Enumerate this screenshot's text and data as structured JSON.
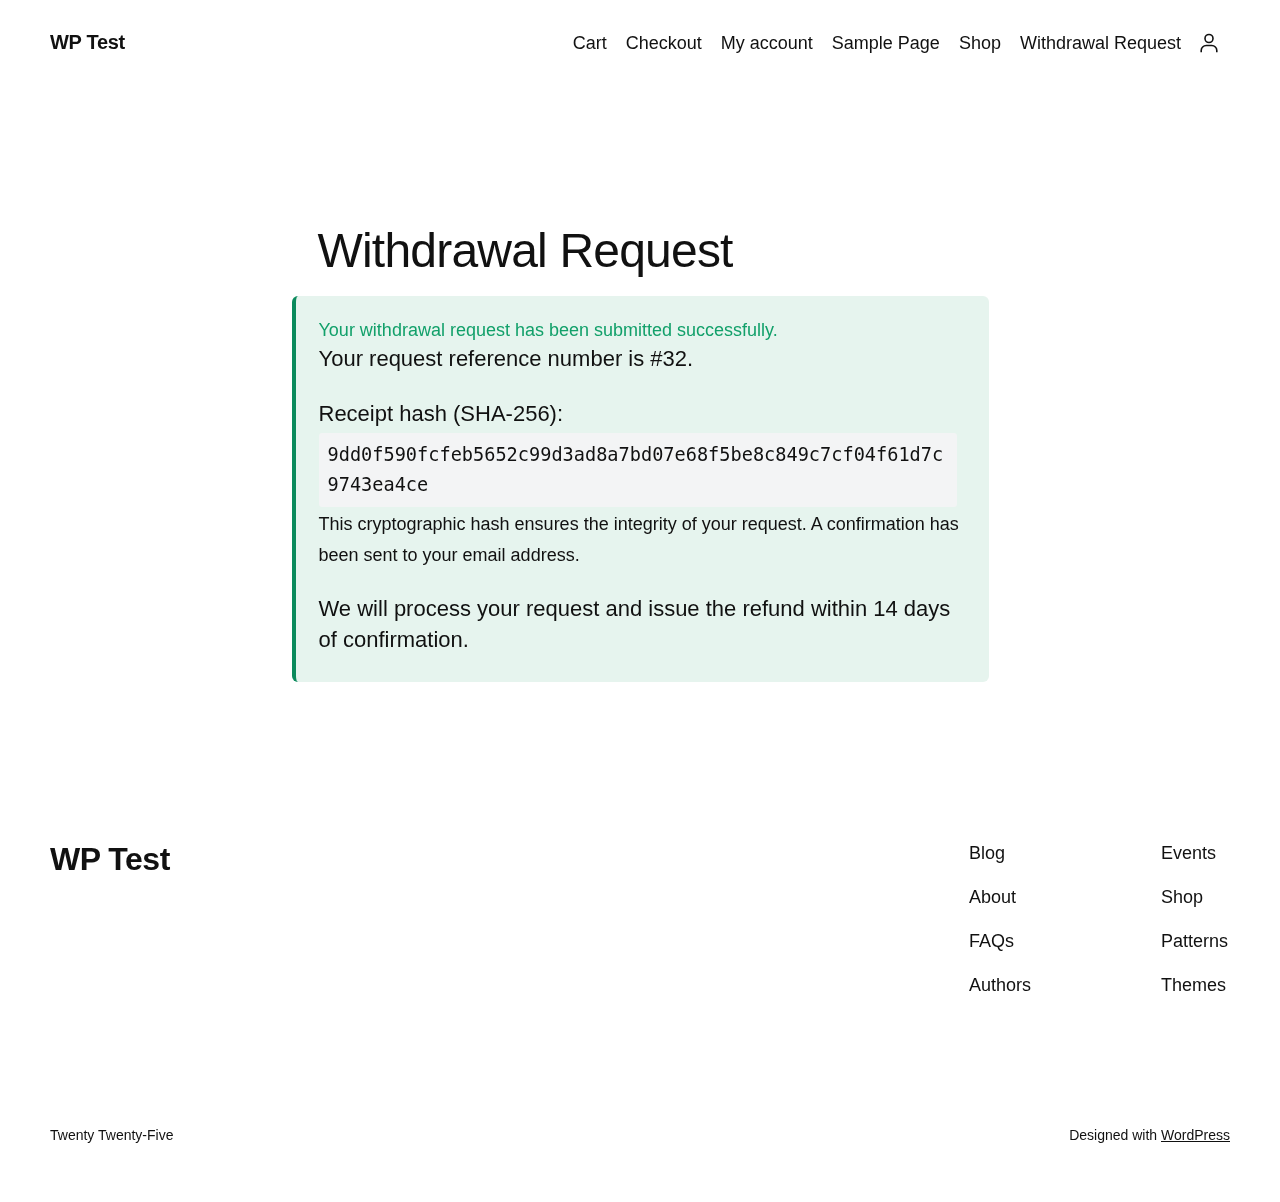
{
  "header": {
    "site_title": "WP Test",
    "nav": [
      "Cart",
      "Checkout",
      "My account",
      "Sample Page",
      "Shop",
      "Withdrawal Request"
    ]
  },
  "page": {
    "title": "Withdrawal Request"
  },
  "notice": {
    "success_message": "Your withdrawal request has been submitted successfully.",
    "reference": "Your request reference number is #32.",
    "hash_label": "Receipt hash (SHA-256):",
    "hash": "9dd0f590fcfeb5652c99d3ad8a7bd07e68f5be8c849c7cf04f61d7c9743ea4ce",
    "hash_note": "This cryptographic hash ensures the integrity of your request. A confirmation has been sent to your email address.",
    "refund_note": "We will process your request and issue the refund within 14 days of confirmation."
  },
  "footer": {
    "site_title": "WP Test",
    "columns": [
      [
        "Blog",
        "About",
        "FAQs",
        "Authors"
      ],
      [
        "Events",
        "Shop",
        "Patterns",
        "Themes"
      ]
    ],
    "theme": "Twenty Twenty-Five",
    "credit": {
      "text": "Designed with",
      "link": "WordPress"
    }
  }
}
